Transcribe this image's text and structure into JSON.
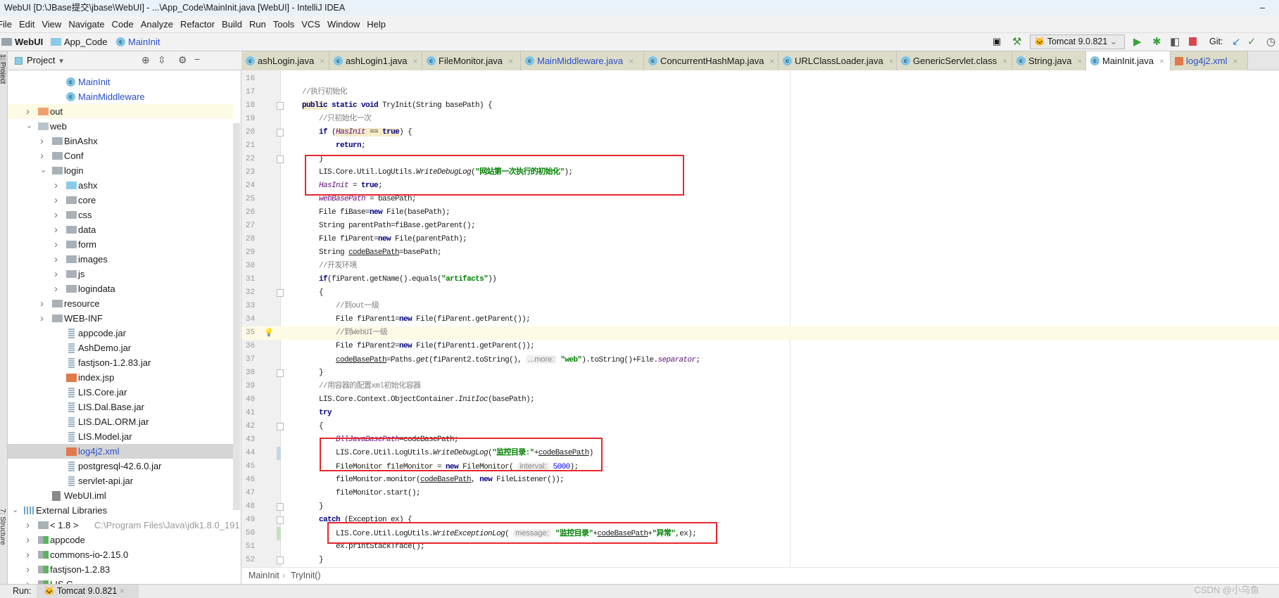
{
  "window": {
    "title": "WebUI [D:\\JBase提交\\jbase\\WebUI] - ...\\App_Code\\MainInit.java [WebUI] - IntelliJ IDEA",
    "minimize": "–"
  },
  "menu": [
    "File",
    "Edit",
    "View",
    "Navigate",
    "Code",
    "Analyze",
    "Refactor",
    "Build",
    "Run",
    "Tools",
    "VCS",
    "Window",
    "Help"
  ],
  "nav": {
    "crumbs": [
      "WebUI",
      "App_Code",
      "MainInit"
    ],
    "run_config": "Tomcat 9.0.821",
    "git_label": "Git:"
  },
  "project_panel": {
    "title": "Project",
    "side_tabs": [
      "1: Project",
      "7: Structure"
    ],
    "tree": [
      {
        "label": "MainInit",
        "level": 3,
        "icon": "class",
        "link": true
      },
      {
        "label": "MainMiddleware",
        "level": 3,
        "icon": "class",
        "link": true
      },
      {
        "label": "out",
        "level": 1,
        "icon": "folder-orange",
        "arrow": "right",
        "highlight": "yellow"
      },
      {
        "label": "web",
        "level": 1,
        "icon": "web-folder",
        "arrow": "down"
      },
      {
        "label": "BinAshx",
        "level": 2,
        "icon": "folder",
        "arrow": "right"
      },
      {
        "label": "Conf",
        "level": 2,
        "icon": "folder",
        "arrow": "right"
      },
      {
        "label": "login",
        "level": 2,
        "icon": "folder",
        "arrow": "down"
      },
      {
        "label": "ashx",
        "level": 3,
        "icon": "folder-blue",
        "arrow": "right"
      },
      {
        "label": "core",
        "level": 3,
        "icon": "folder",
        "arrow": "right"
      },
      {
        "label": "css",
        "level": 3,
        "icon": "folder",
        "arrow": "right"
      },
      {
        "label": "data",
        "level": 3,
        "icon": "folder",
        "arrow": "right"
      },
      {
        "label": "form",
        "level": 3,
        "icon": "folder",
        "arrow": "right"
      },
      {
        "label": "images",
        "level": 3,
        "icon": "folder",
        "arrow": "right"
      },
      {
        "label": "js",
        "level": 3,
        "icon": "folder",
        "arrow": "right"
      },
      {
        "label": "logindata",
        "level": 3,
        "icon": "folder",
        "arrow": "right"
      },
      {
        "label": "resource",
        "level": 2,
        "icon": "folder",
        "arrow": "right"
      },
      {
        "label": "WEB-INF",
        "level": 2,
        "icon": "folder",
        "arrow": "right"
      },
      {
        "label": "appcode.jar",
        "level": 3,
        "icon": "jar"
      },
      {
        "label": "AshDemo.jar",
        "level": 3,
        "icon": "jar"
      },
      {
        "label": "fastjson-1.2.83.jar",
        "level": 3,
        "icon": "jar"
      },
      {
        "label": "index.jsp",
        "level": 3,
        "icon": "jsp"
      },
      {
        "label": "LIS.Core.jar",
        "level": 3,
        "icon": "jar"
      },
      {
        "label": "LIS.Dal.Base.jar",
        "level": 3,
        "icon": "jar"
      },
      {
        "label": "LIS.DAL.ORM.jar",
        "level": 3,
        "icon": "jar"
      },
      {
        "label": "LIS.Model.jar",
        "level": 3,
        "icon": "jar"
      },
      {
        "label": "log4j2.xml",
        "level": 3,
        "icon": "xml",
        "link": true,
        "selected": true
      },
      {
        "label": "postgresql-42.6.0.jar",
        "level": 3,
        "icon": "jar"
      },
      {
        "label": "servlet-api.jar",
        "level": 3,
        "icon": "jar"
      },
      {
        "label": "WebUI.iml",
        "level": 2,
        "icon": "iml"
      },
      {
        "label": "External Libraries",
        "level": 0,
        "icon": "libraries",
        "arrow": "down"
      },
      {
        "label": "< 1.8 >",
        "level": 1,
        "icon": "jdk",
        "arrow": "right",
        "extra": "C:\\Program Files\\Java\\jdk1.8.0_191"
      },
      {
        "label": "appcode",
        "level": 1,
        "icon": "library",
        "arrow": "right"
      },
      {
        "label": "commons-io-2.15.0",
        "level": 1,
        "icon": "library",
        "arrow": "right"
      },
      {
        "label": "fastjson-1.2.83",
        "level": 1,
        "icon": "library",
        "arrow": "right"
      },
      {
        "label": "LIS.C...",
        "level": 1,
        "icon": "library",
        "arrow": "right"
      }
    ]
  },
  "tabs": [
    {
      "label": "ashLogin.java",
      "icon": "class"
    },
    {
      "label": "ashLogin1.java",
      "icon": "class"
    },
    {
      "label": "FileMonitor.java",
      "icon": "class"
    },
    {
      "label": "MainMiddleware.java",
      "icon": "class",
      "link": true
    },
    {
      "label": "ConcurrentHashMap.java",
      "icon": "class"
    },
    {
      "label": "URLClassLoader.java",
      "icon": "class"
    },
    {
      "label": "GenericServlet.class",
      "icon": "class"
    },
    {
      "label": "String.java",
      "icon": "class"
    },
    {
      "label": "MainInit.java",
      "icon": "class",
      "active": true
    },
    {
      "label": "log4j2.xml",
      "icon": "xml",
      "link": true
    }
  ],
  "editor": {
    "caret_line": 35,
    "highlight_boxes": [
      [
        22,
        24
      ],
      [
        43,
        45
      ],
      [
        50,
        50
      ]
    ],
    "lines": [
      {
        "n": 16,
        "s": []
      },
      {
        "n": 17,
        "s": [
          [
            "//执行初始化",
            "cm"
          ]
        ]
      },
      {
        "n": 18,
        "s": [
          [
            "public",
            "kw hl"
          ],
          [
            " static void",
            "kw"
          ],
          [
            " TryInit(String basePath) {",
            ""
          ]
        ]
      },
      {
        "n": 19,
        "s": [
          [
            "    //只初始化一次",
            "cm"
          ]
        ]
      },
      {
        "n": 20,
        "s": [
          [
            "    ",
            ""
          ],
          [
            "if",
            "kw"
          ],
          [
            " (",
            ""
          ],
          [
            "HasInit",
            "fd hl"
          ],
          [
            " == ",
            "hl"
          ],
          [
            "true",
            "kw hl"
          ],
          [
            ") {",
            ""
          ]
        ]
      },
      {
        "n": 21,
        "s": [
          [
            "        ",
            ""
          ],
          [
            "return",
            "kw"
          ],
          [
            ";",
            ""
          ]
        ]
      },
      {
        "n": 22,
        "s": [
          [
            "    }",
            ""
          ]
        ]
      },
      {
        "n": 23,
        "s": [
          [
            "    LIS.Core.Util.LogUtils.",
            ""
          ],
          [
            "WriteDebugLog",
            "it"
          ],
          [
            "(",
            ""
          ],
          [
            "\"网站第一次执行的初始化\"",
            "st"
          ],
          [
            ");",
            ""
          ]
        ]
      },
      {
        "n": 24,
        "s": [
          [
            "    ",
            ""
          ],
          [
            "HasInit",
            "fd"
          ],
          [
            " = ",
            ""
          ],
          [
            "true",
            "kw"
          ],
          [
            ";",
            ""
          ]
        ]
      },
      {
        "n": 25,
        "s": [
          [
            "    ",
            ""
          ],
          [
            "webBasePath",
            "fd"
          ],
          [
            " = basePath;",
            ""
          ]
        ]
      },
      {
        "n": 26,
        "s": [
          [
            "    File fiBase=",
            ""
          ],
          [
            "new",
            "kw"
          ],
          [
            " File(basePath);",
            ""
          ]
        ]
      },
      {
        "n": 27,
        "s": [
          [
            "    String parentPath=fiBase.getParent();",
            ""
          ]
        ]
      },
      {
        "n": 28,
        "s": [
          [
            "    File fiParent=",
            ""
          ],
          [
            "new",
            "kw"
          ],
          [
            " File(parentPath);",
            ""
          ]
        ]
      },
      {
        "n": 29,
        "s": [
          [
            "    String ",
            ""
          ],
          [
            "codeBasePath",
            "ul"
          ],
          [
            "=basePath;",
            ""
          ]
        ]
      },
      {
        "n": 30,
        "s": [
          [
            "    //开发环境",
            "cm"
          ]
        ]
      },
      {
        "n": 31,
        "s": [
          [
            "    ",
            ""
          ],
          [
            "if",
            "kw"
          ],
          [
            "(fiParent.getName().equals(",
            ""
          ],
          [
            "\"artifacts\"",
            "st"
          ],
          [
            "))",
            ""
          ]
        ]
      },
      {
        "n": 32,
        "s": [
          [
            "    {",
            ""
          ]
        ]
      },
      {
        "n": 33,
        "s": [
          [
            "        //到out一级",
            "cm"
          ]
        ]
      },
      {
        "n": 34,
        "s": [
          [
            "        File fiParent1=",
            ""
          ],
          [
            "new",
            "kw"
          ],
          [
            " File(fiParent.getParent());",
            ""
          ]
        ]
      },
      {
        "n": 35,
        "s": [
          [
            "        //到WebUI一级",
            "cm"
          ]
        ]
      },
      {
        "n": 36,
        "s": [
          [
            "        File fiParent2=",
            ""
          ],
          [
            "new",
            "kw"
          ],
          [
            " File(fiParent1.getParent());",
            ""
          ]
        ]
      },
      {
        "n": 37,
        "s": [
          [
            "        ",
            ""
          ],
          [
            "codeBasePath",
            "ul"
          ],
          [
            "=Paths.",
            ""
          ],
          [
            "get",
            "it"
          ],
          [
            "(fiParent2.toString(), ",
            ""
          ],
          [
            "...more:",
            "hint"
          ],
          [
            " ",
            ""
          ],
          [
            "\"web\"",
            "st"
          ],
          [
            ").toString()+File.",
            ""
          ],
          [
            "separator",
            "fd"
          ],
          [
            ";",
            ""
          ]
        ]
      },
      {
        "n": 38,
        "s": [
          [
            "    }",
            ""
          ]
        ]
      },
      {
        "n": 39,
        "s": [
          [
            "    //用容器的配置xml初始化容器",
            "cm"
          ]
        ]
      },
      {
        "n": 40,
        "s": [
          [
            "    LIS.Core.Context.ObjectContainer.",
            ""
          ],
          [
            "InitIoc",
            "it"
          ],
          [
            "(basePath);",
            ""
          ]
        ]
      },
      {
        "n": 41,
        "s": [
          [
            "    ",
            ""
          ],
          [
            "try",
            "kw"
          ]
        ]
      },
      {
        "n": 42,
        "s": [
          [
            "    {",
            ""
          ]
        ]
      },
      {
        "n": 43,
        "s": [
          [
            "        ",
            ""
          ],
          [
            "BllJavaBasePath",
            "fd"
          ],
          [
            "=codeBasePath;",
            ""
          ]
        ]
      },
      {
        "n": 44,
        "s": [
          [
            "        LIS.Core.Util.LogUtils.",
            ""
          ],
          [
            "WriteDebugLog",
            "it"
          ],
          [
            "(",
            ""
          ],
          [
            "\"监控目录:\"",
            "st"
          ],
          [
            "+",
            ""
          ],
          [
            "codeBasePath",
            "ul"
          ],
          [
            ")",
            ""
          ]
        ]
      },
      {
        "n": 45,
        "s": [
          [
            "        FileMonitor fileMonitor = ",
            ""
          ],
          [
            "new",
            "kw"
          ],
          [
            " FileMonitor( ",
            ""
          ],
          [
            "interval:",
            "hint"
          ],
          [
            " ",
            ""
          ],
          [
            "5000",
            "num2"
          ],
          [
            ");",
            ""
          ]
        ]
      },
      {
        "n": 46,
        "s": [
          [
            "        fileMonitor.monitor(",
            ""
          ],
          [
            "codeBasePath",
            "ul"
          ],
          [
            ", ",
            ""
          ],
          [
            "new",
            "kw"
          ],
          [
            " FileListener());",
            ""
          ]
        ]
      },
      {
        "n": 47,
        "s": [
          [
            "        fileMonitor.start();",
            ""
          ]
        ]
      },
      {
        "n": 48,
        "s": [
          [
            "    }",
            ""
          ]
        ]
      },
      {
        "n": 49,
        "s": [
          [
            "    ",
            ""
          ],
          [
            "catch",
            "kw"
          ],
          [
            " (Exception ex) {",
            ""
          ]
        ]
      },
      {
        "n": 50,
        "s": [
          [
            "        LIS.Core.Util.LogUtils.",
            ""
          ],
          [
            "WriteExceptionLog",
            "it"
          ],
          [
            "( ",
            ""
          ],
          [
            "message:",
            "hint"
          ],
          [
            " ",
            ""
          ],
          [
            "\"监控目录\"",
            "st"
          ],
          [
            "+",
            ""
          ],
          [
            "codeBasePath",
            "ul"
          ],
          [
            "+",
            ""
          ],
          [
            "\"异常\"",
            "st"
          ],
          [
            ",ex);",
            ""
          ]
        ]
      },
      {
        "n": 51,
        "s": [
          [
            "        ex.printStackTrace();",
            ""
          ]
        ]
      },
      {
        "n": 52,
        "s": [
          [
            "    }",
            ""
          ]
        ]
      }
    ]
  },
  "breadcrumb": {
    "class": "MainInit",
    "method": "TryInit()"
  },
  "run": {
    "label": "Run:",
    "tab": "Tomcat 9.0.821"
  },
  "watermark": "CSDN @小乌鱼",
  "colors": {
    "highlight_box": "#e8262e",
    "string": "#008000",
    "keyword": "#000080",
    "field": "#660e7a"
  }
}
